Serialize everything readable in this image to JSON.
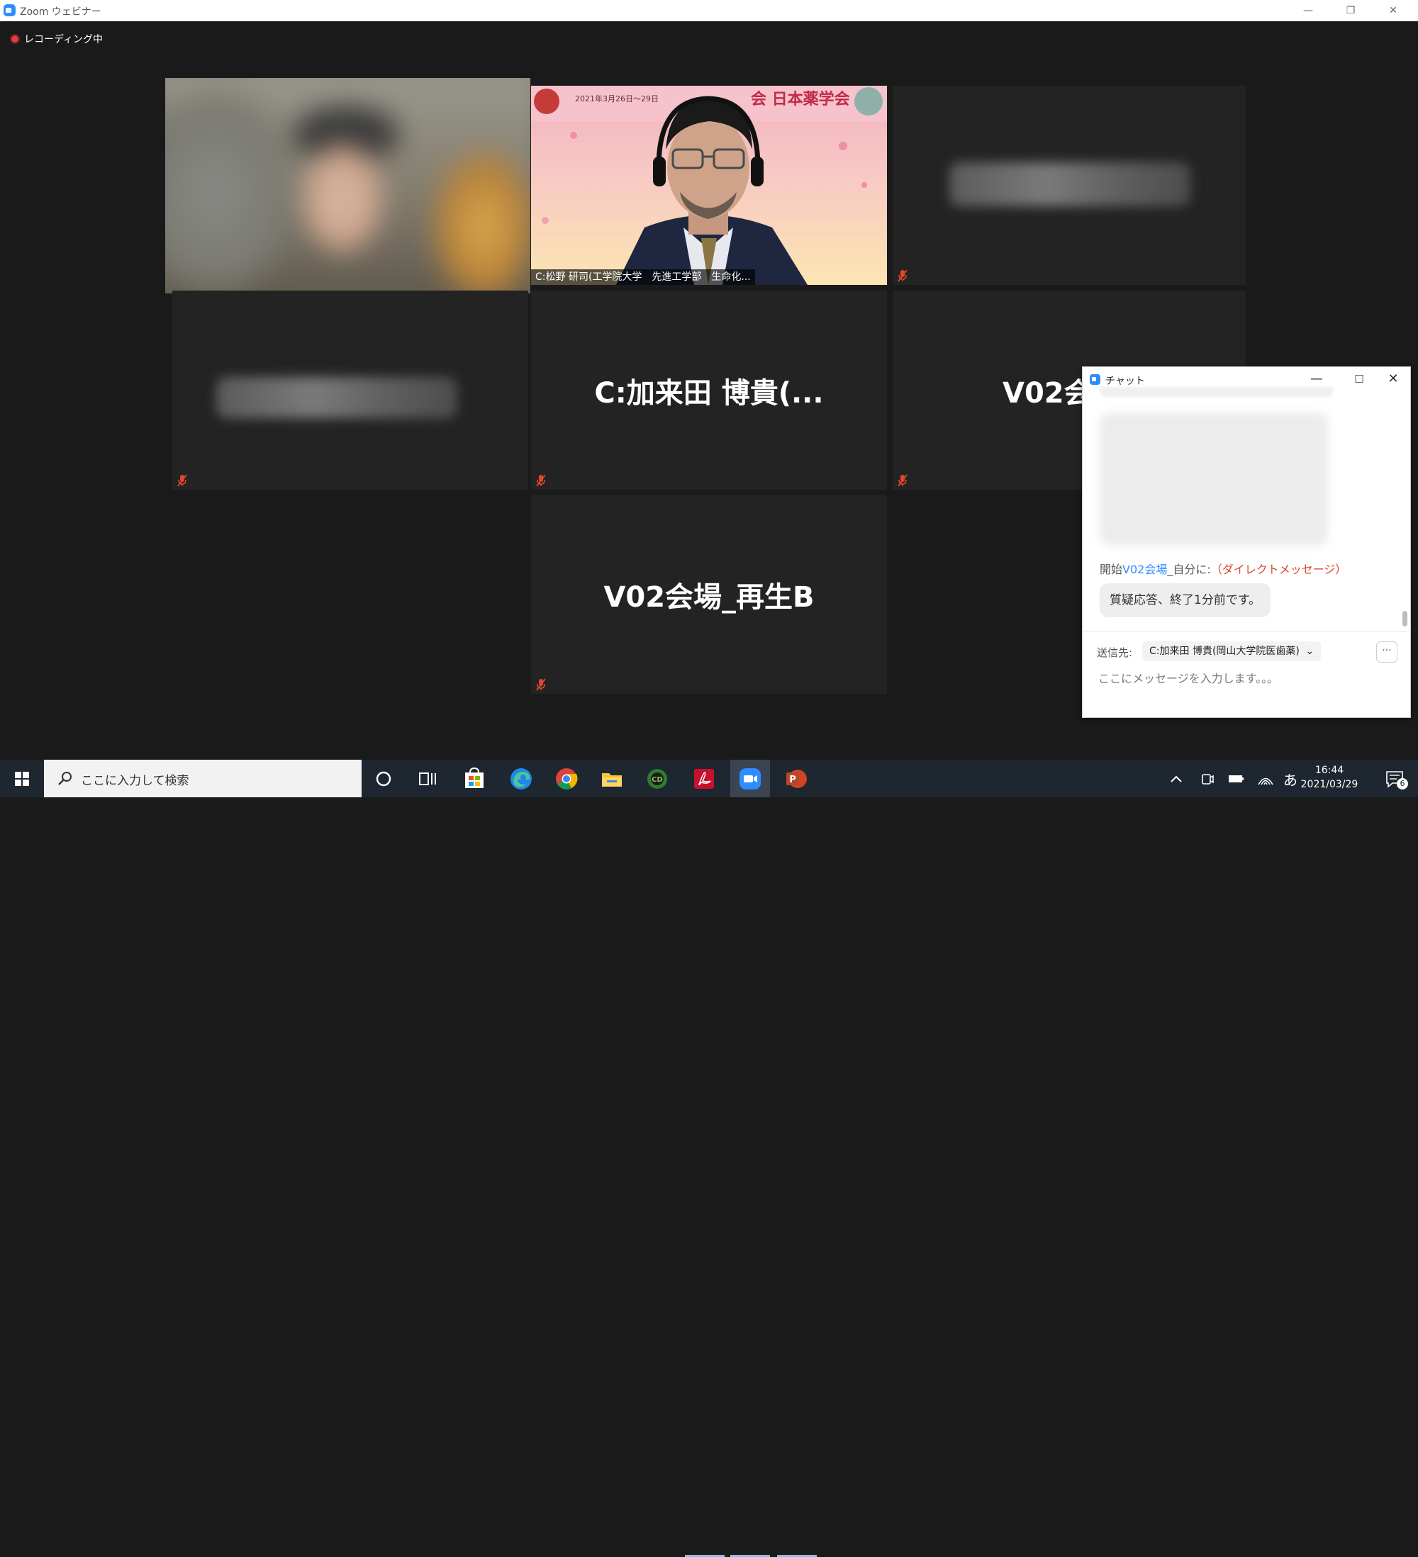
{
  "window": {
    "title": "Zoom ウェビナー"
  },
  "recording": {
    "label": "レコーディング中"
  },
  "tiles": {
    "speaker_name": "C:松野 研司(工学院大学　先進工学部　生命化...",
    "t5_name": "C:加来田 博貴(...",
    "t6_name": "V02会",
    "t8_name": "V02会場_再生B"
  },
  "chat": {
    "title": "チャット",
    "sender_prefix": "開始",
    "sender_from": "V02会場",
    "sender_to": "_自分に:",
    "sender_dm": "（ダイレクトメッセージ）",
    "message": "質疑応答、終了1分前です。",
    "to_label": "送信先:",
    "to_value": "C:加来田 博貴(岡山大学院医歯薬)",
    "more_label": "···",
    "input_placeholder": "ここにメッセージを入力します。。。"
  },
  "taskbar": {
    "search_placeholder": "ここに入力して検索",
    "time": "16:44",
    "date": "2021/03/29",
    "notification_count": "6",
    "ime": "あ"
  },
  "colors": {
    "zoom_blue": "#2D8CFF",
    "mute_red": "#e0462a",
    "powerpoint": "#d04423",
    "acrobat": "#c8102e"
  }
}
